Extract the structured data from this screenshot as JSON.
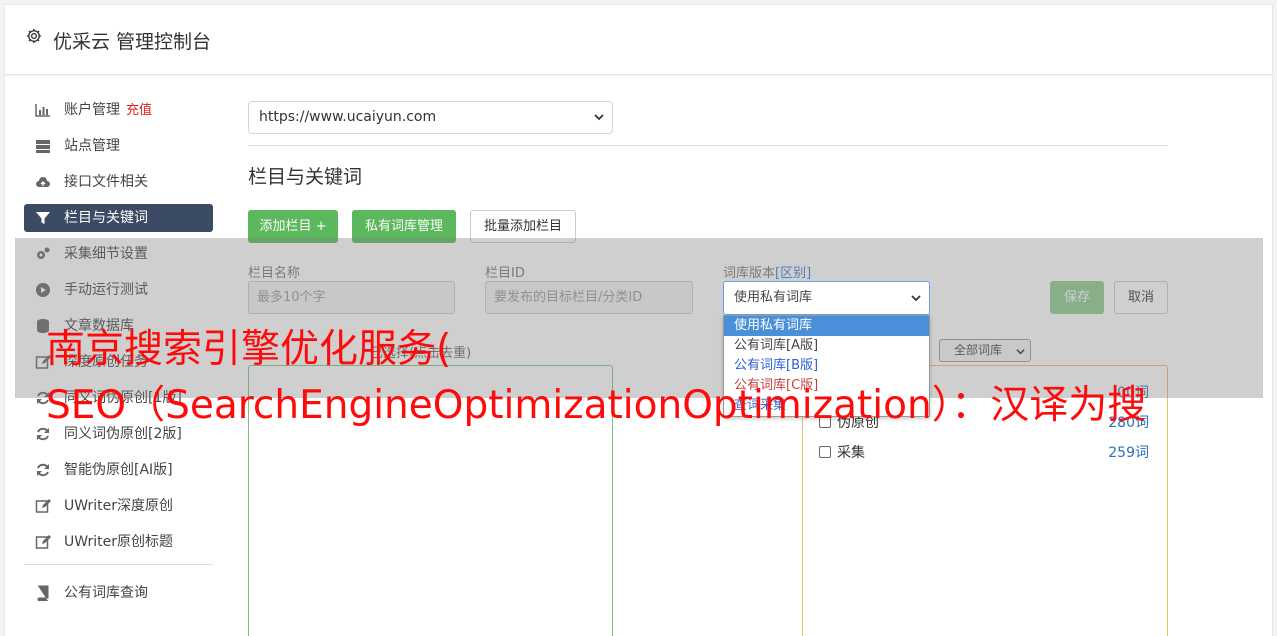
{
  "header": {
    "title": "优采云 管理控制台",
    "icon": "gear-icon"
  },
  "sidebar": {
    "items": [
      {
        "label": "账户管理",
        "badge": "充值",
        "icon": "bar-chart-icon"
      },
      {
        "label": "站点管理",
        "icon": "server-icon"
      },
      {
        "label": "接口文件相关",
        "icon": "cloud-upload-icon"
      },
      {
        "label": "栏目与关键词",
        "icon": "filter-icon",
        "active": true
      },
      {
        "label": "采集细节设置",
        "icon": "cogs-icon"
      },
      {
        "label": "手动运行测试",
        "icon": "play-circle-icon"
      },
      {
        "label": "文章数据库",
        "icon": "database-icon"
      },
      {
        "label": "深度原创任务",
        "icon": "edit-icon"
      },
      {
        "label": "同义词伪原创[1版]",
        "icon": "refresh-icon"
      },
      {
        "label": "同义词伪原创[2版]",
        "icon": "refresh-icon"
      },
      {
        "label": "智能伪原创[AI版]",
        "icon": "refresh-icon"
      },
      {
        "label": "UWriter深度原创",
        "icon": "edit-icon"
      },
      {
        "label": "UWriter原创标题",
        "icon": "edit-icon"
      },
      {
        "label": "公有词库查询",
        "icon": "book-icon"
      }
    ]
  },
  "main": {
    "site_select": "https://www.ucaiyun.com",
    "section_title": "栏目与关键词",
    "buttons": {
      "add_column": "添加栏目 +",
      "private_lib": "私有词库管理",
      "batch_add": "批量添加栏目"
    },
    "form": {
      "name_label": "栏目名称",
      "name_placeholder": "最多10个字",
      "id_label": "栏目ID",
      "id_placeholder": "要发布的目标栏目/分类ID",
      "lib_label": "词库版本",
      "lib_label_link": "[区别]",
      "lib_selected": "使用私有词库",
      "save": "保存",
      "cancel": "取消"
    },
    "dropdown_options": [
      "使用私有词库",
      "公有词库[A版]",
      "公有词库[B版]",
      "公有词库[C版]",
      "查词采集"
    ],
    "caption": "已选择(点击去重)",
    "filter_select": "全部词库",
    "keyword_groups": [
      {
        "label": "伪原创",
        "count": "280词"
      },
      {
        "label": "采集",
        "count": "259词"
      }
    ],
    "hidden_count": "00词"
  },
  "watermark": {
    "line1": "南京搜索引擎优化服务(",
    "line2": "SEO（SearchEngineOptimizationOptimization）：汉译为搜"
  }
}
